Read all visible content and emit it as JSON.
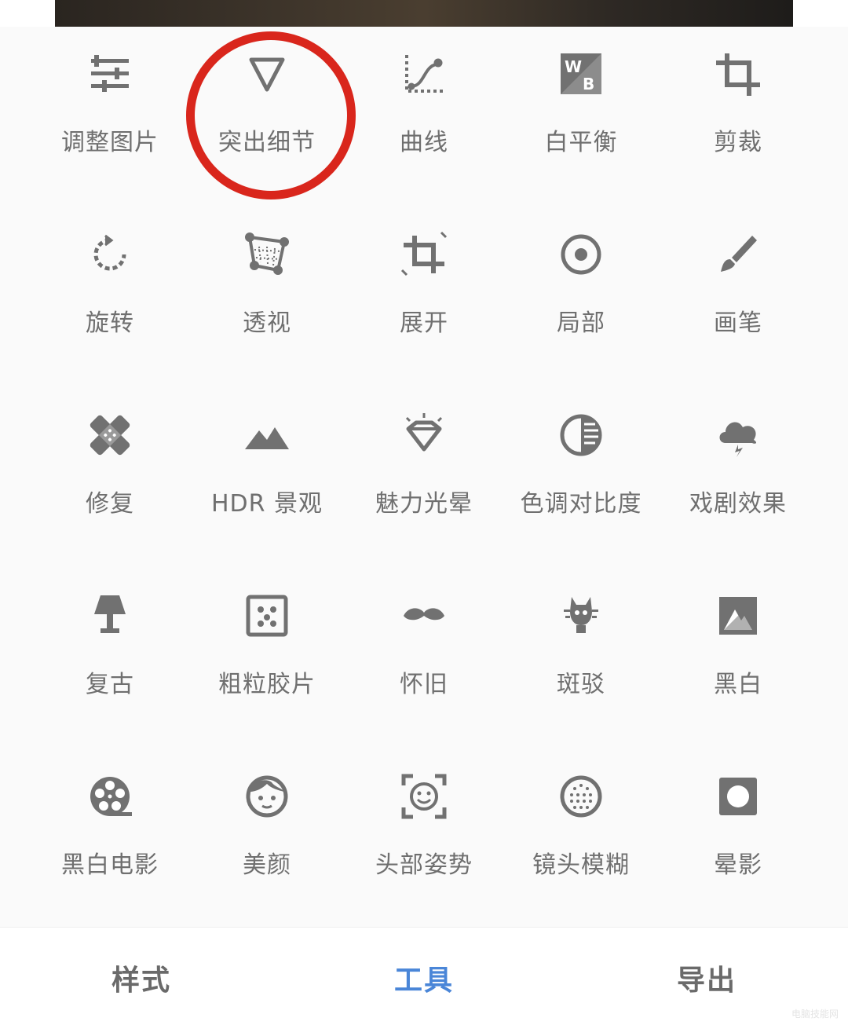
{
  "colors": {
    "icon": "#717171",
    "label": "#6f6f6f",
    "highlight_ring": "#d9261c",
    "active_tab": "#4a86d8",
    "inactive_tab": "#6a6a6a"
  },
  "tools": [
    {
      "label": "调整图片",
      "icon": "sliders-icon"
    },
    {
      "label": "突出细节",
      "icon": "triangle-down-icon"
    },
    {
      "label": "曲线",
      "icon": "curve-icon"
    },
    {
      "label": "白平衡",
      "icon": "white-balance-icon"
    },
    {
      "label": "剪裁",
      "icon": "crop-icon"
    },
    {
      "label": "旋转",
      "icon": "rotate-icon"
    },
    {
      "label": "透视",
      "icon": "perspective-icon"
    },
    {
      "label": "展开",
      "icon": "expand-icon"
    },
    {
      "label": "局部",
      "icon": "selective-icon"
    },
    {
      "label": "画笔",
      "icon": "brush-icon"
    },
    {
      "label": "修复",
      "icon": "healing-icon"
    },
    {
      "label": "HDR 景观",
      "icon": "mountain-icon"
    },
    {
      "label": "魅力光晕",
      "icon": "diamond-glow-icon"
    },
    {
      "label": "色调对比度",
      "icon": "tonal-contrast-icon"
    },
    {
      "label": "戏剧效果",
      "icon": "storm-cloud-icon"
    },
    {
      "label": "复古",
      "icon": "lamp-icon"
    },
    {
      "label": "粗粒胶片",
      "icon": "grain-icon"
    },
    {
      "label": "怀旧",
      "icon": "mustache-icon"
    },
    {
      "label": "斑驳",
      "icon": "grunge-icon"
    },
    {
      "label": "黑白",
      "icon": "black-white-icon"
    },
    {
      "label": "黑白电影",
      "icon": "film-reel-icon"
    },
    {
      "label": "美颜",
      "icon": "face-icon"
    },
    {
      "label": "头部姿势",
      "icon": "head-pose-icon"
    },
    {
      "label": "镜头模糊",
      "icon": "lens-blur-icon"
    },
    {
      "label": "晕影",
      "icon": "vignette-icon"
    }
  ],
  "bottom_nav": {
    "styles": "样式",
    "tools": "工具",
    "export": "导出"
  },
  "watermark": "电脑技能网"
}
